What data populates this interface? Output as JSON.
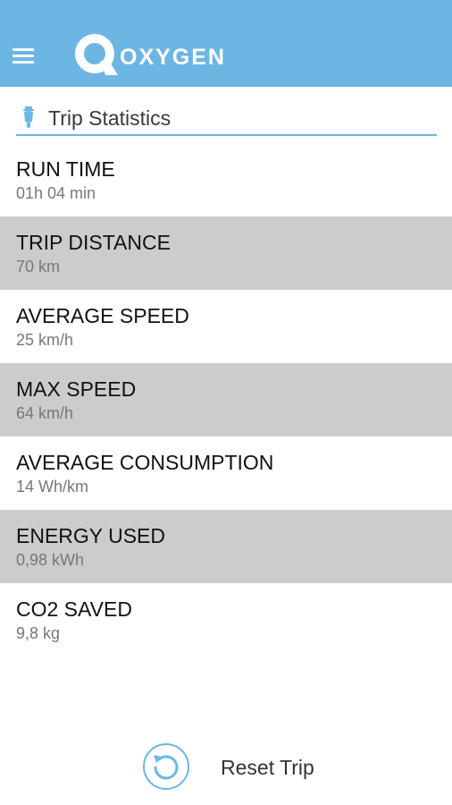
{
  "header": {
    "logo_text": "OXYGEN",
    "menu_icon": "hamburger-menu-icon",
    "background_color": "#6cb6e3"
  },
  "section": {
    "title": "Trip Statistics",
    "icon": "scooter-icon",
    "accent_color": "#6cb6e3"
  },
  "stats": [
    {
      "label": "RUN TIME",
      "value": "01h 04 min"
    },
    {
      "label": "TRIP DISTANCE",
      "value": "70 km"
    },
    {
      "label": "AVERAGE SPEED",
      "value": "25 km/h"
    },
    {
      "label": "MAX SPEED",
      "value": "64 km/h"
    },
    {
      "label": "AVERAGE CONSUMPTION",
      "value": "14 Wh/km"
    },
    {
      "label": "ENERGY USED",
      "value": "0,98 kWh"
    },
    {
      "label": "CO2 SAVED",
      "value": "9,8 kg"
    }
  ],
  "reset": {
    "label": "Reset Trip",
    "icon": "reset-icon"
  },
  "colors": {
    "row_shaded": "#cccccc",
    "row_plain": "#ffffff"
  }
}
